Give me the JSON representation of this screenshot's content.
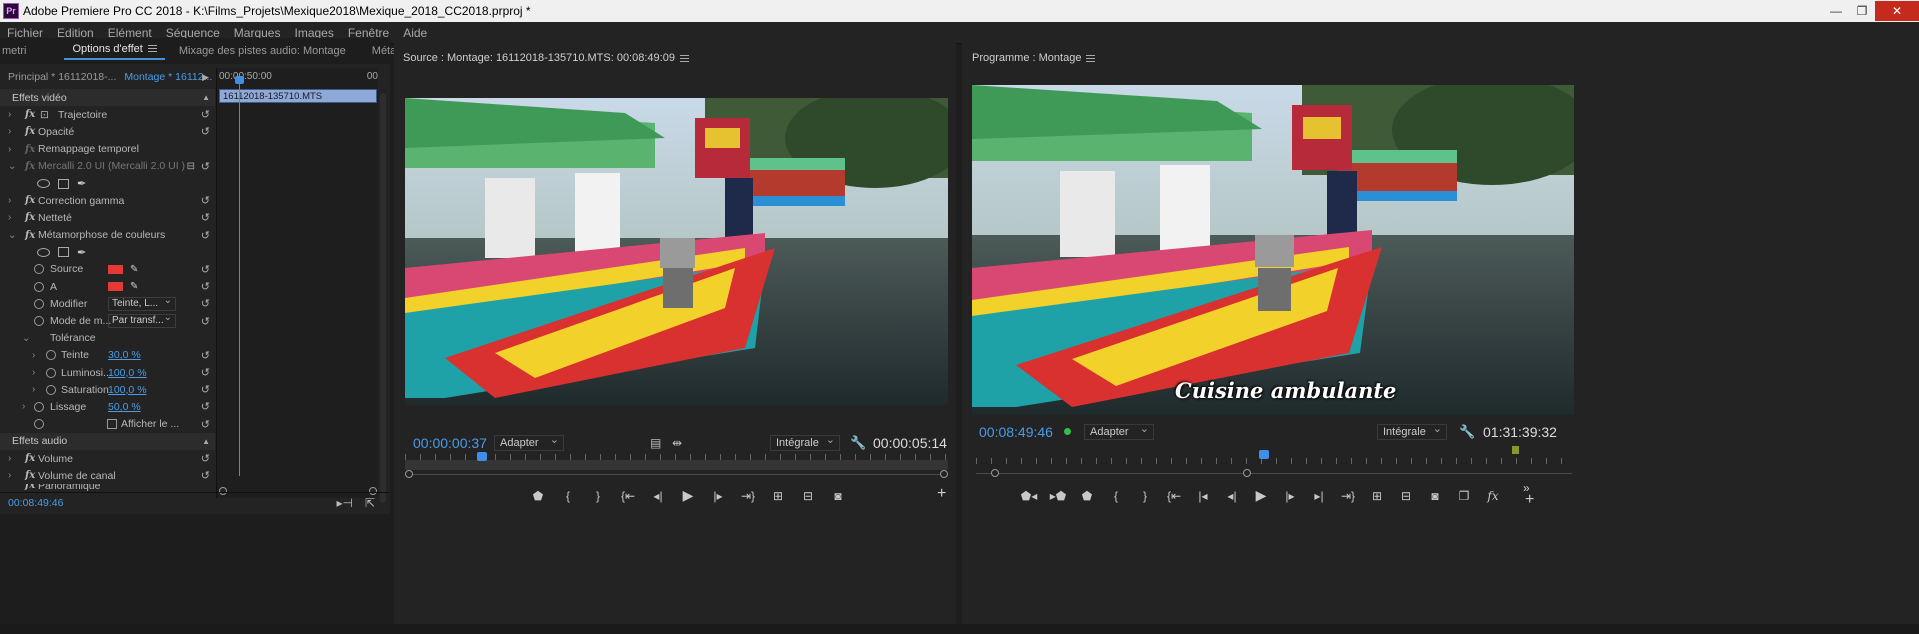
{
  "window": {
    "logo_text": "Pr",
    "title": "Adobe Premiere Pro CC 2018 - K:\\Films_Projets\\Mexique2018\\Mexique_2018_CC2018.prproj *",
    "minimize": "—",
    "maximize": "❐",
    "close": "✕"
  },
  "menu": [
    "Fichier",
    "Edition",
    "Elément",
    "Séquence",
    "Marques",
    "Images",
    "Fenêtre",
    "Aide"
  ],
  "effect_panel": {
    "tabs": {
      "metadata_left": "metri",
      "effect_options": "Options d'effet",
      "audio_mix": "Mixage des pistes audio: Montage",
      "metadata": "Métadonr",
      "more": "»"
    },
    "head": {
      "sequence": "Principal * 16112018-...",
      "clip": "Montage * 16112...",
      "play": "▶"
    },
    "ruler": {
      "time": "00:00:50:00",
      "end": "00"
    },
    "clip_name": "16112018-135710.MTS",
    "sections": {
      "video": "Effets vidéo",
      "audio": "Effets audio"
    },
    "effects": {
      "trajectoire": "Trajectoire",
      "opacite": "Opacité",
      "remappage": "Remappage temporel",
      "mercalli": "Mercalli 2.0 UI (Mercalli 2.0 UI )",
      "gamma": "Correction gamma",
      "nettete": "Netteté",
      "metamorphose": "Métamorphose de couleurs",
      "volume": "Volume",
      "volume_canal": "Volume de canal",
      "panoramique": "Panoramique"
    },
    "params": {
      "source": "Source",
      "a": "A",
      "modifier": "Modifier",
      "modifier_value": "Teinte, L...",
      "mode": "Mode de m...",
      "mode_value": "Par transf...",
      "tolerance": "Tolérance",
      "teinte": "Teinte",
      "teinte_value": "30,0 %",
      "luminosite": "Luminosi...",
      "luminosite_value": "100,0 %",
      "saturation": "Saturation",
      "saturation_value": "100,0 %",
      "lissage": "Lissage",
      "lissage_value": "50,0 %",
      "afficher": "Afficher le ..."
    },
    "footer_timecode": "00:08:49:46",
    "colors": {
      "source": "#e53935",
      "a": "#e53935"
    }
  },
  "source_monitor": {
    "title": "Source : Montage: 16112018-135710.MTS: 00:08:49:09",
    "timecode": "00:00:00:37",
    "fit": "Adapter",
    "quality": "Intégrale",
    "duration": "00:00:05:14"
  },
  "program_monitor": {
    "title": "Programme : Montage",
    "timecode": "00:08:49:46",
    "fit": "Adapter",
    "quality": "Intégrale",
    "duration": "01:31:39:32",
    "overlay_title": "Cuisine ambulante"
  },
  "accent": "#4a9be8"
}
